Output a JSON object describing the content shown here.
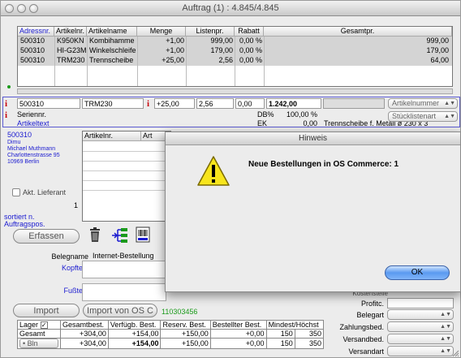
{
  "window": {
    "title": "Auftrag (1) : 4.845/4.845"
  },
  "items": {
    "columns": [
      "Adressnr.",
      "Artikelnr.",
      "Artikelname",
      "Menge",
      "Listenpr.",
      "Rabatt",
      "Gesamtpr."
    ],
    "rows": [
      [
        "500310",
        "K950KN",
        "Kombihamme",
        "+1,00",
        "999,00",
        "0,00 %",
        "999,00"
      ],
      [
        "500310",
        "HI-G23MR",
        "Winkelschleife",
        "+1,00",
        "179,00",
        "0,00 %",
        "179,00"
      ],
      [
        "500310",
        "TRM230",
        "Trennscheibe",
        "+25,00",
        "2,56",
        "0,00 %",
        "64,00"
      ]
    ]
  },
  "edit": {
    "adressnr": "500310",
    "artikelnr": "TRM230",
    "menge": "+25,00",
    "listenpr": "2,56",
    "rabatt": "0,00",
    "gesamt": "1.242,00",
    "seriennr_label": "Seriennr.",
    "artikeltext_label": "Artikeltext",
    "db_label": "DB%",
    "db_value": "100,00 %",
    "ek_label": "EK",
    "ek_value": "0,00",
    "description": "Trennscheibe f. Metall ø 230 x 3",
    "popup1": "Artikelnummer",
    "popup2": "Stücklistenart"
  },
  "address": {
    "nr": "500310",
    "name1": "Dimu",
    "name2": "Michael Muthmann",
    "street": "Charlottenstrasse 95",
    "city": "10969 Berlin"
  },
  "subgrid": {
    "col1": "Artikelnr.",
    "col2": "Art"
  },
  "supplier": {
    "label": "Akt. Lieferant",
    "value": "1"
  },
  "sort": {
    "line1": "sortiert n.",
    "line2": "Auftragspos."
  },
  "buttons": {
    "erfassen": "Erfassen",
    "import": "Import",
    "import_os": "Import von OS C",
    "ok": "OK"
  },
  "import_number": "110303456",
  "texts": {
    "belegname_label": "Belegname",
    "belegname_value": "Internet-Bestellung",
    "kopftext_label": "Kopftext",
    "fusstext_label": "Fußtext"
  },
  "right_panel": {
    "kostenstelle": "Kostenstelle",
    "profitc": "Profitc.",
    "belegart": "Belegart",
    "zahlungsbed": "Zahlungsbed.",
    "versandbed": "Versandbed.",
    "versandart": "Versandart"
  },
  "stock": {
    "headers": [
      "Lager",
      "Gesamtbest.",
      "Verfügb. Best.",
      "Reserv. Best.",
      "Bestellter Best.",
      "Mindest/Höchst"
    ],
    "rows": [
      [
        "Gesamt",
        "+304,00",
        "+154,00",
        "+150,00",
        "+0,00",
        "150",
        "350"
      ]
    ],
    "lager_select": "• Bln",
    "lager_row": [
      "+304,00",
      "+154,00",
      "+150,00",
      "+0,00",
      "150",
      "350"
    ]
  },
  "dialog": {
    "title": "Hinweis",
    "message": "Neue Bestellungen in OS Commerce: 1"
  },
  "colors": {
    "link_blue": "#1a1ad0",
    "info_red": "#c8000a",
    "ok_blue": "#5a9af0",
    "green": "#1a9a1a"
  }
}
